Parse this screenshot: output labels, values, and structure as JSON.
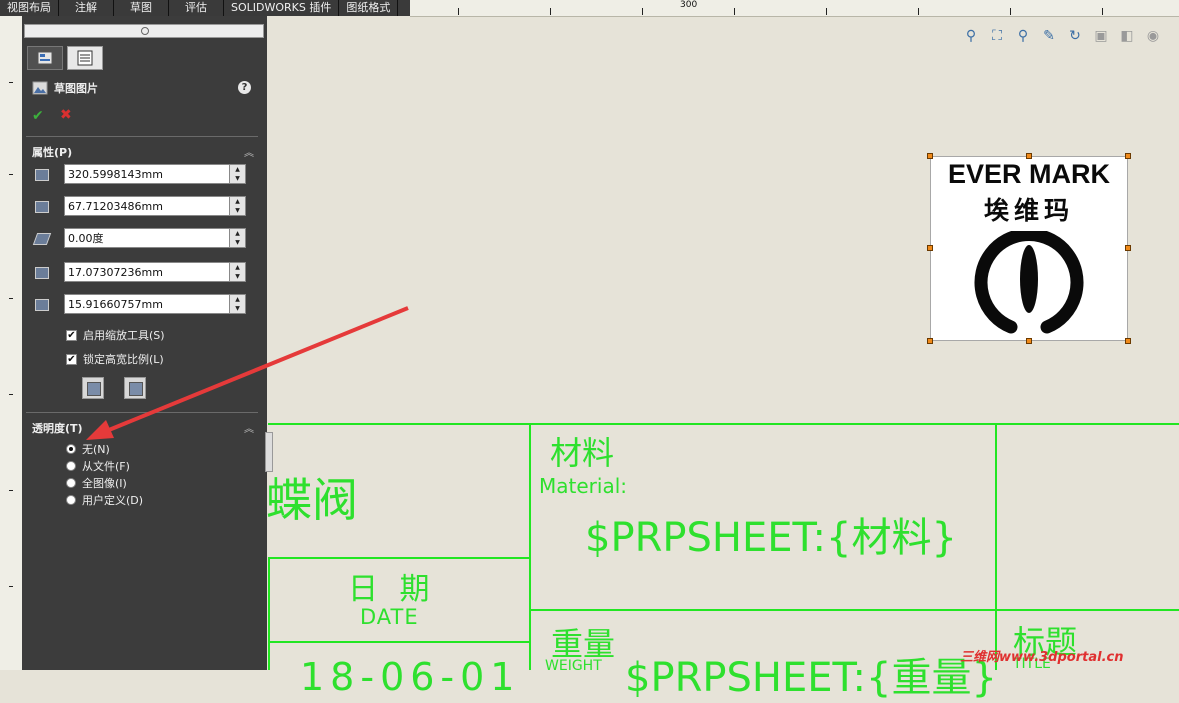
{
  "tabs": [
    "视图布局",
    "注解",
    "草图",
    "评估",
    "SOLIDWORKS 插件",
    "图纸格式"
  ],
  "ruler": {
    "mark": "300"
  },
  "property_manager": {
    "title": "草图图片",
    "help": "?",
    "properties_section": "属性(P)",
    "fields": [
      {
        "value": "320.5998143mm"
      },
      {
        "value": "67.71203486mm"
      },
      {
        "value": "0.00度"
      },
      {
        "value": "17.07307236mm"
      },
      {
        "value": "15.91660757mm"
      }
    ],
    "checkboxes": [
      {
        "label": "启用缩放工具(S)",
        "checked": true
      },
      {
        "label": "锁定高宽比例(L)",
        "checked": true
      }
    ],
    "transparency_section": "透明度(T)",
    "radios": [
      {
        "label": "无(N)",
        "selected": true
      },
      {
        "label": "从文件(F)",
        "selected": false
      },
      {
        "label": "全图像(I)",
        "selected": false
      },
      {
        "label": "用户定义(D)",
        "selected": false
      }
    ]
  },
  "logo": {
    "english": "EVER MARK",
    "chinese": "埃维玛"
  },
  "title_block": {
    "name_partial": "蝶阀",
    "material_cn": "材料",
    "material_en": "Material:",
    "material_value": "$PRPSHEET:{材料}",
    "date_cn": "日 期",
    "date_en": "DATE",
    "weight_cn": "重量",
    "weight_en": "WEIGHT",
    "weight_value": "$PRPSHEET:{重量}",
    "title_cn": "标题",
    "title_en": "TITLE",
    "date_value": "18-06-01"
  },
  "watermark": "三维网www.3dportal.cn",
  "colors": {
    "cad_green": "#22e622",
    "handle": "#f08a1a",
    "arrow": "#e53a3a"
  }
}
